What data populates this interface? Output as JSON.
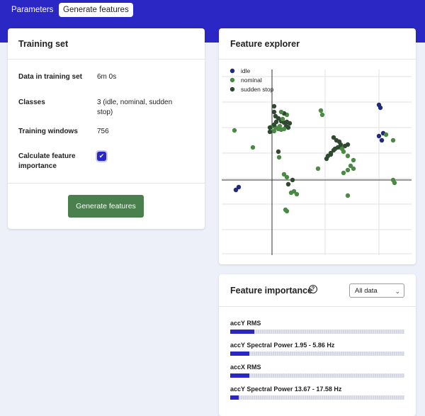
{
  "tabs": {
    "parameters": "Parameters",
    "generate_features": "Generate features"
  },
  "training_set": {
    "title": "Training set",
    "rows": {
      "data_label": "Data in training set",
      "data_value": "6m 0s",
      "classes_label": "Classes",
      "classes_value": "3 (idle, nominal, sudden stop)",
      "windows_label": "Training windows",
      "windows_value": "756",
      "importance_label": "Calculate feature importance",
      "importance_checked": true
    },
    "button": "Generate features"
  },
  "explorer": {
    "title": "Feature explorer",
    "legend": [
      {
        "name": "idle",
        "color": "#1f2a78"
      },
      {
        "name": "nominal",
        "color": "#4a8a45"
      },
      {
        "name": "sudden stop",
        "color": "#2f4a30"
      }
    ]
  },
  "importance": {
    "title": "Feature importance",
    "help_icon": "help-circle-icon",
    "filter_value": "All data",
    "features": [
      {
        "name": "accY RMS",
        "value": 0.14
      },
      {
        "name": "accY Spectral Power 1.95 - 5.86 Hz",
        "value": 0.11
      },
      {
        "name": "accX RMS",
        "value": 0.11
      },
      {
        "name": "accY Spectral Power 13.67 - 17.58 Hz",
        "value": 0.05
      }
    ]
  }
}
